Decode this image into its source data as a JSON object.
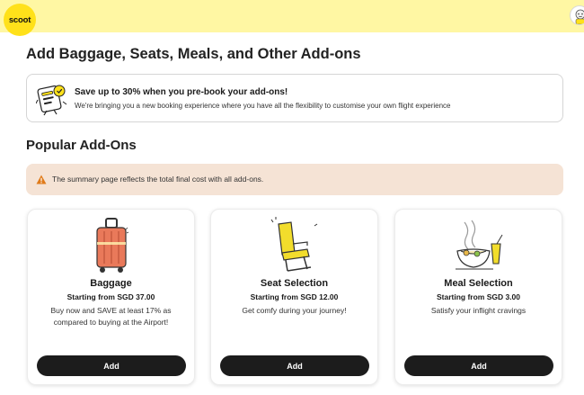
{
  "header": {
    "logo_text": "scoot",
    "brand_color": "#ffe11a",
    "bar_color": "#fff7a3"
  },
  "page": {
    "title": "Add Baggage, Seats, Meals, and Other Add-ons"
  },
  "promo": {
    "icon": "addons-illustration-icon",
    "title": "Save up to 30% when you pre-book your add-ons!",
    "text": "We're bringing you a new booking experience where you have all the flexibility to customise your own flight experience"
  },
  "section": {
    "title": "Popular Add-Ons"
  },
  "notice": {
    "icon": "warning-icon",
    "text": "The summary page reflects the total final cost with all add-ons.",
    "bg_color": "#f5e3d5"
  },
  "cards": [
    {
      "icon": "suitcase-icon",
      "title": "Baggage",
      "price": "Starting from SGD 37.00",
      "description": "Buy now and SAVE at least 17% as compared to buying at the Airport!",
      "button": "Add"
    },
    {
      "icon": "seat-icon",
      "title": "Seat Selection",
      "price": "Starting from SGD 12.00",
      "description": "Get comfy during your journey!",
      "button": "Add"
    },
    {
      "icon": "meal-icon",
      "title": "Meal Selection",
      "price": "Starting from SGD 3.00",
      "description": "Satisfy your inflight cravings",
      "button": "Add"
    }
  ]
}
